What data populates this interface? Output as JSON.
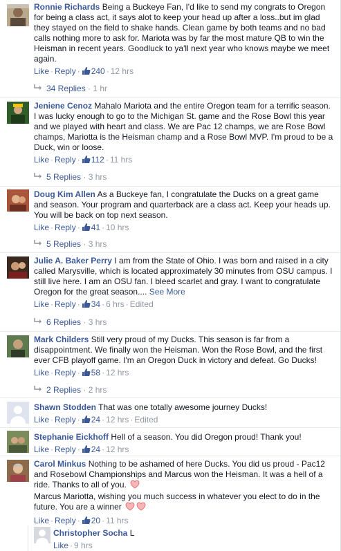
{
  "comments": [
    {
      "name": "Ronnie Richards",
      "text": "Being a Buckeye Fan, I'd like to send my congrats to Oregon for being a class act, it says alot to keep your head up after a loss..but im glad they stayed on the field to shake hands. Clean game by both teams and no bad calls nothing more to ask for. Mariota was by far the most mature QB to win the Heisman in recent years. Goodluck to ya'll next year who knows maybe we meet again.",
      "like": "Like",
      "reply": "Reply",
      "likes": "240",
      "time": "12 hrs",
      "replies": "34 Replies",
      "replies_time": "1 hr"
    },
    {
      "name": "Jeniene Cenoz",
      "text": "Mahalo Mariota and the entire Oregon team for a terrific season. I was lucky enough to go to the Michigan St. game and the Rose Bowl this year and we played with heart and class. We are Pac 12 champs, we are Rose Bowl champs, Mariotta is the Heisman champ and a Rose Bowl MVP. I'm proud to be a Duck, win or loose.",
      "like": "Like",
      "reply": "Reply",
      "likes": "112",
      "time": "11 hrs",
      "replies": "5 Replies",
      "replies_time": "3 hrs"
    },
    {
      "name": "Doug Kim Allen",
      "text": "As a Buckeye fan, I congratulate the Ducks on a great game and season. Your program and quarterback are a class act. Keep your heads up. You will be back on top next season.",
      "like": "Like",
      "reply": "Reply",
      "likes": "41",
      "time": "10 hrs",
      "replies": "5 Replies",
      "replies_time": "3 hrs"
    },
    {
      "name": "Julie A. Baker Perry",
      "text": "I am from the State of Ohio. I was born and raised in a city called Marysville, which is located approximately 30 minutes from OSU campus. I still live here. I am an OSU fan. I bleed scarlet and gray. I want to congratulate Oregon for the great season....",
      "see_more": "See More",
      "like": "Like",
      "reply": "Reply",
      "likes": "34",
      "time": "6 hrs",
      "edited": "Edited",
      "replies": "6 Replies",
      "replies_time": "3 hrs"
    },
    {
      "name": "Mark Childers",
      "text": "Still very proud of my Ducks. This season is far from a disappointment. We finally won the Heisman. Won the Rose Bowl, and the first ever CFB playoff game. I'm an Oregon Duck in victory and defeat. Go Ducks!",
      "like": "Like",
      "reply": "Reply",
      "likes": "58",
      "time": "12 hrs",
      "replies": "2 Replies",
      "replies_time": "2 hrs"
    },
    {
      "name": "Shawn Stodden",
      "text": "That was one totally awesome journey Ducks!",
      "like": "Like",
      "reply": "Reply",
      "likes": "24",
      "time": "12 hrs",
      "edited": "Edited"
    },
    {
      "name": "Stephanie Eickhoff",
      "text": "Hell of a season. You did Oregon proud! Thank you!",
      "like": "Like",
      "reply": "Reply",
      "likes": "24",
      "time": "12 hrs"
    },
    {
      "name": "Carol Minkus",
      "text": "Nothing to be ashamed of here Ducks. You did us proud - Pac12 and Rosebowl Championships and Marcus won the Heisman. It was a hell of a ride. Thanks to all of you.",
      "text2": "Marcus Mariotta, wishing you much success in whatever you elect to do in the future. You are a winner",
      "like": "Like",
      "reply": "Reply",
      "likes": "20",
      "time": "11 hrs"
    }
  ],
  "nested": {
    "name": "Christopher Socha",
    "text": "L",
    "like": "Like",
    "time": "9 hrs"
  },
  "colors": {
    "link": "#3b5998",
    "meta": "#9197a3",
    "text": "#141823",
    "heart": "#e57373"
  }
}
